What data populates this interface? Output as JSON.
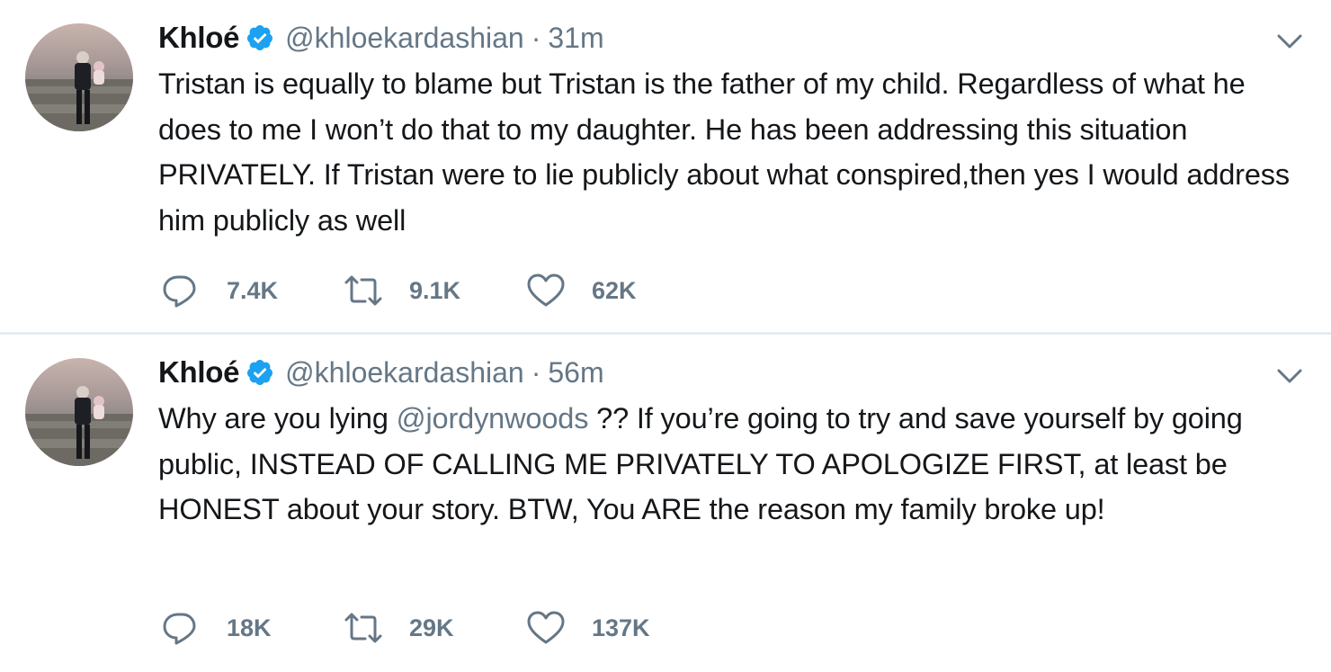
{
  "tweets": [
    {
      "name": "Khloé",
      "handle": "@khloekardashian",
      "separator": "·",
      "time": "31m",
      "text_parts": [
        "Tristan is equally to blame but Tristan is the father of my child. Regardless of what he does to me I won’t do that to my daughter. He has been addressing this situation PRIVATELY. If Tristan were to lie publicly about what conspired,then yes I would address him publicly as well"
      ],
      "replies": "7.4K",
      "retweets": "9.1K",
      "likes": "62K"
    },
    {
      "name": "Khloé",
      "handle": "@khloekardashian",
      "separator": "·",
      "time": "56m",
      "text_before": "Why are you lying ",
      "mention": "@jordynwoods",
      "text_after": " ?? If you’re going to try and save yourself by going public, INSTEAD OF CALLING ME PRIVATELY TO APOLOGIZE FIRST, at least be HONEST about your story. BTW, You ARE the reason my family broke up!",
      "replies": "18K",
      "retweets": "29K",
      "likes": "137K"
    }
  ],
  "colors": {
    "text": "#14171a",
    "secondary": "#657786",
    "verified": "#1da1f2",
    "divider": "#e6ecf0"
  },
  "icons": {
    "verified": "verified-badge-icon",
    "menu": "chevron-down-icon",
    "reply": "reply-icon",
    "retweet": "retweet-icon",
    "like": "heart-icon"
  }
}
